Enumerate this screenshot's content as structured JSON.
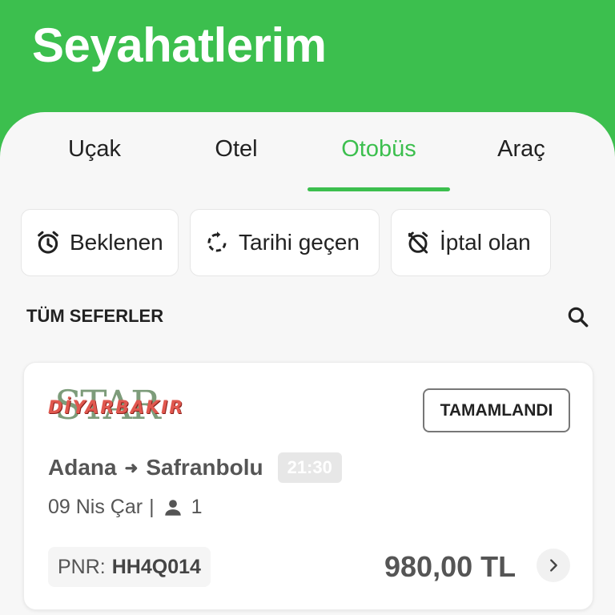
{
  "header": {
    "title": "Seyahatlerim"
  },
  "tabs": [
    {
      "label": "Uçak",
      "active": false
    },
    {
      "label": "Otel",
      "active": false
    },
    {
      "label": "Otobüs",
      "active": true
    },
    {
      "label": "Araç",
      "active": false
    }
  ],
  "filters": [
    {
      "label": "Beklenen",
      "icon": "alarm-clock-icon"
    },
    {
      "label": "Tarihi geçen",
      "icon": "refresh-icon"
    },
    {
      "label": "İptal olan",
      "icon": "alarm-off-icon"
    }
  ],
  "section": {
    "title": "TÜM SEFERLER",
    "search_icon": "search-icon"
  },
  "trip": {
    "logo_top": "STAR",
    "logo_bottom": "DİYARBAKIR",
    "status": "TAMAMLANDI",
    "origin": "Adana",
    "destination": "Safranbolu",
    "time": "21:30",
    "date": "09 Nis Çar",
    "separator": "|",
    "passengers": "1",
    "pnr_label": "PNR:",
    "pnr_code": "HH4Q014",
    "price": "980,00 TL"
  },
  "colors": {
    "accent": "#3cbf4e",
    "background": "#f7f7f7"
  }
}
